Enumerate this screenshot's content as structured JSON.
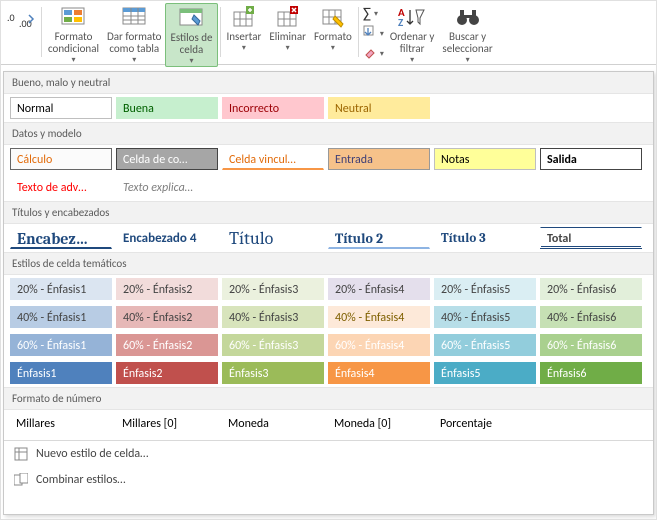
{
  "ribbon": {
    "increase_decimal": "",
    "format_cond": "Formato\ncondicional",
    "format_table": "Dar formato\ncomo tabla",
    "cell_styles": "Estilos de\ncelda",
    "insert": "Insertar",
    "delete": "Eliminar",
    "format": "Formato",
    "autosum": "",
    "fill": "",
    "clear": "",
    "sort_filter": "Ordenar y\nfiltrar",
    "find_select": "Buscar y\nseleccionar"
  },
  "sections": {
    "good_bad": "Bueno, malo y neutral",
    "data_model": "Datos y modelo",
    "titles": "Títulos y encabezados",
    "themed": "Estilos de celda temáticos",
    "number_fmt": "Formato de número"
  },
  "styles": {
    "good_bad": {
      "normal": "Normal",
      "buena": "Buena",
      "incorrecto": "Incorrecto",
      "neutral": "Neutral"
    },
    "data_model_r1": {
      "calculo": "Cálculo",
      "celda_comp": "Celda de co…",
      "celda_vinc": "Celda vincul…",
      "entrada": "Entrada",
      "notas": "Notas",
      "salida": "Salida"
    },
    "data_model_r2": {
      "texto_adv": "Texto de adv…",
      "texto_exp": "Texto explica…"
    },
    "titles_row": {
      "encabez": "Encabez…",
      "encabezado4": "Encabezado 4",
      "titulo": "Título",
      "titulo2": "Título 2",
      "titulo3": "Título 3",
      "total": "Total"
    },
    "accent20": {
      "a1": "20% - Énfasis1",
      "a2": "20% - Énfasis2",
      "a3": "20% - Énfasis3",
      "a4": "20% - Énfasis4",
      "a5": "20% - Énfasis5",
      "a6": "20% - Énfasis6"
    },
    "accent40": {
      "a1": "40% - Énfasis1",
      "a2": "40% - Énfasis2",
      "a3": "40% - Énfasis3",
      "a4": "40% - Énfasis4",
      "a5": "40% - Énfasis5",
      "a6": "40% - Énfasis6"
    },
    "accent60": {
      "a1": "60% - Énfasis1",
      "a2": "60% - Énfasis2",
      "a3": "60% - Énfasis3",
      "a4": "60% - Énfasis4",
      "a5": "60% - Énfasis5",
      "a6": "60% - Énfasis6"
    },
    "accent100": {
      "a1": "Énfasis1",
      "a2": "Énfasis2",
      "a3": "Énfasis3",
      "a4": "Énfasis4",
      "a5": "Énfasis5",
      "a6": "Énfasis6"
    },
    "numbers": {
      "millares": "Millares",
      "millares0": "Millares [0]",
      "moneda": "Moneda",
      "moneda0": "Moneda [0]",
      "porcentaje": "Porcentaje"
    }
  },
  "footer": {
    "new_style": "Nuevo estilo de celda…",
    "merge_styles": "Combinar estilos…"
  }
}
